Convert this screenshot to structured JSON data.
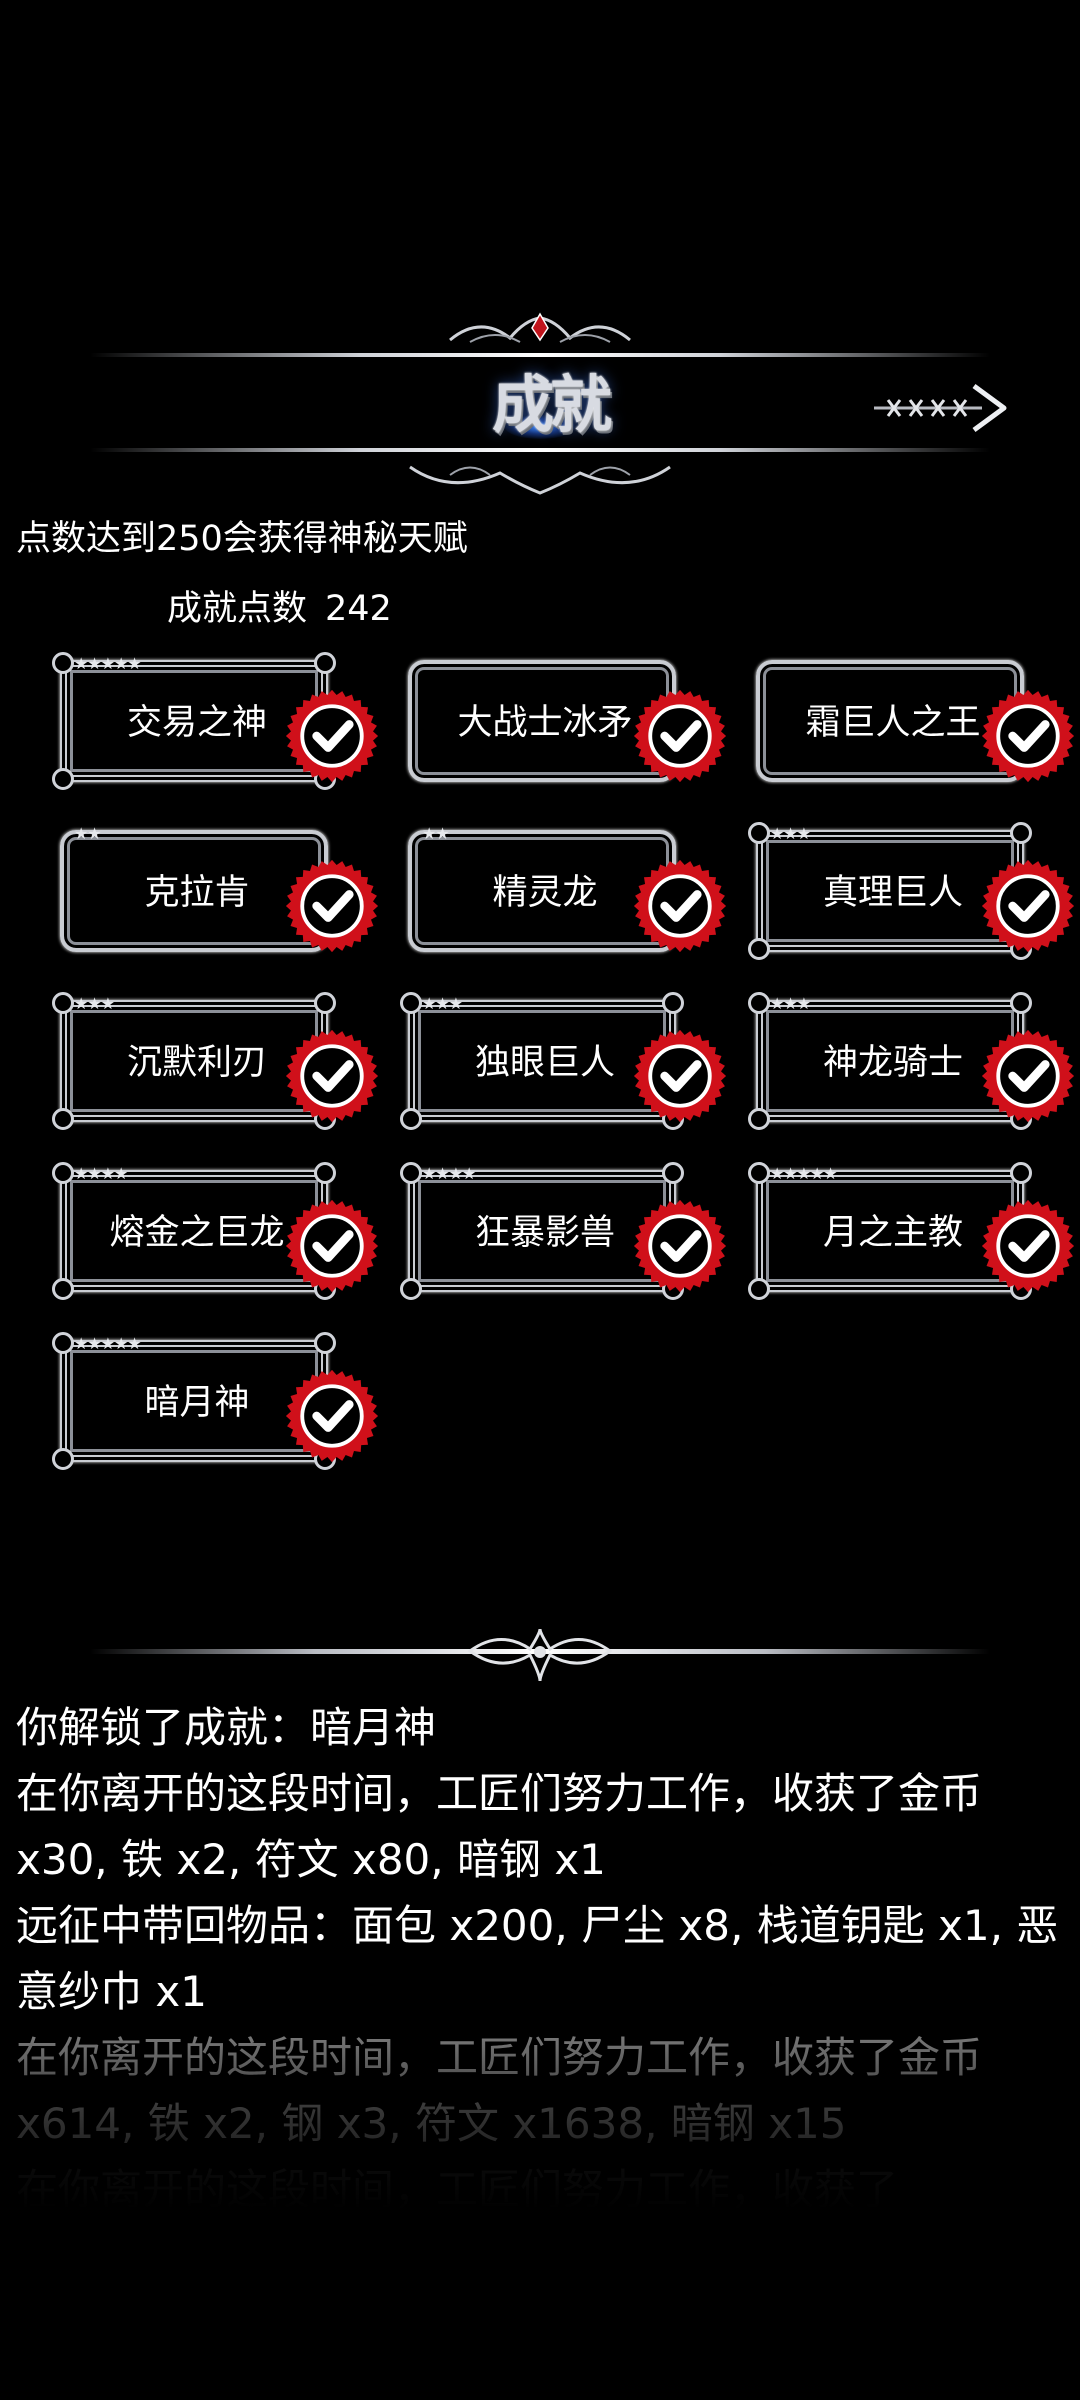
{
  "header": {
    "title": "成就",
    "close_icon": "x-arrow-close-icon"
  },
  "subtitle": "点数达到250会获得神秘天赋",
  "points": {
    "label": "成就点数",
    "value": "242"
  },
  "achievements": [
    {
      "name": "交易之神",
      "stars": "★★★★★",
      "completed": true,
      "frame": "ornate"
    },
    {
      "name": "大战士冰矛",
      "stars": "",
      "completed": true,
      "frame": "plain"
    },
    {
      "name": "霜巨人之王",
      "stars": "",
      "completed": true,
      "frame": "plain"
    },
    {
      "name": "克拉肯",
      "stars": "★★",
      "completed": true,
      "frame": "plain"
    },
    {
      "name": "精灵龙",
      "stars": "★★",
      "completed": true,
      "frame": "plain"
    },
    {
      "name": "真理巨人",
      "stars": "★★★",
      "completed": true,
      "frame": "ornate"
    },
    {
      "name": "沉默利刃",
      "stars": "★★★",
      "completed": true,
      "frame": "ornate"
    },
    {
      "name": "独眼巨人",
      "stars": "★★★",
      "completed": true,
      "frame": "ornate"
    },
    {
      "name": "神龙骑士",
      "stars": "★★★",
      "completed": true,
      "frame": "ornate"
    },
    {
      "name": "熔金之巨龙",
      "stars": "★★★★",
      "completed": true,
      "frame": "ornate"
    },
    {
      "name": "狂暴影兽",
      "stars": "★★★★",
      "completed": true,
      "frame": "ornate"
    },
    {
      "name": "月之主教",
      "stars": "★★★★★",
      "completed": true,
      "frame": "ornate"
    },
    {
      "name": "暗月神",
      "stars": "★★★★★",
      "completed": true,
      "frame": "ornate"
    }
  ],
  "log": [
    {
      "text": "你解锁了成就：暗月神",
      "opacity": 1
    },
    {
      "text": "在你离开的这段时间，工匠们努力工作，收获了金币 x30, 铁 x2, 符文 x80, 暗钢 x1",
      "opacity": 1
    },
    {
      "text": "远征中带回物品：面包 x200, 尸尘 x8, 栈道钥匙 x1, 恶意纱巾 x1",
      "opacity": 1
    },
    {
      "text": "在你离开的这段时间，工匠们努力工作，收获了金币 x614, 铁 x2, 钢 x3, 符文 x1638, 暗钢 x15",
      "opacity": 0.85
    },
    {
      "text": "在你离开的这段时间，工匠们努力工作，收获了",
      "opacity": 0.35
    }
  ],
  "colors": {
    "badge_red": "#d0101a",
    "frame_silver": "#c9ccd2",
    "background": "#000000"
  }
}
